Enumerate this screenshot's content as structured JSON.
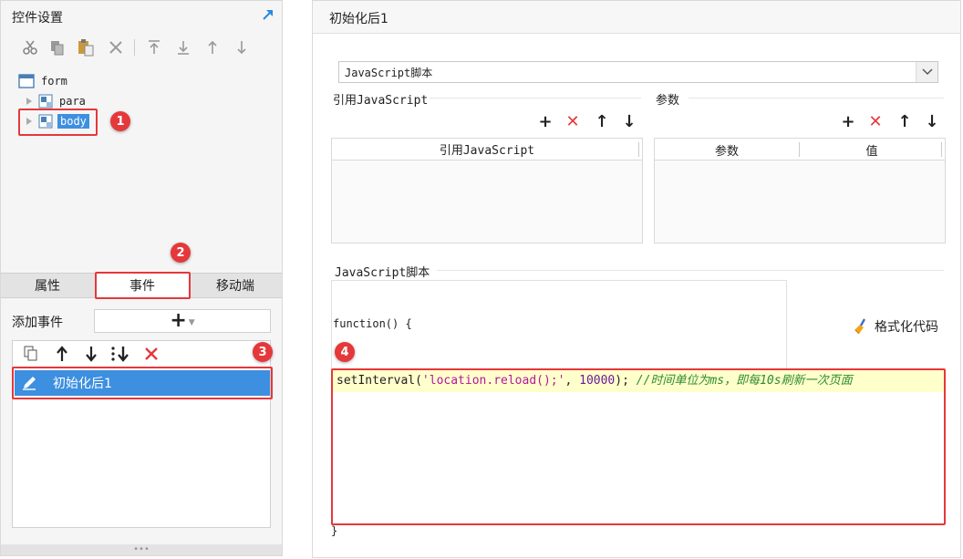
{
  "left_panel": {
    "title": "控件设置",
    "tree": {
      "root": "form",
      "children": [
        "para",
        "body"
      ]
    },
    "tabs": [
      "属性",
      "事件",
      "移动端"
    ],
    "add_event_label": "添加事件",
    "add_event_button": "+",
    "events": [
      "初始化后1"
    ]
  },
  "right_panel": {
    "title": "初始化后1",
    "script_type": "JavaScript脚本",
    "ref_js_label": "引用JavaScript",
    "ref_js_column": "引用JavaScript",
    "params_label": "参数",
    "params_columns": [
      "参数",
      "值"
    ],
    "script_section_label": "JavaScript脚本",
    "function_open": "function() {",
    "code": {
      "fn": "setInterval(",
      "str": "'location.reload();'",
      "sep": ", ",
      "num": "10000",
      "close": "); ",
      "comment_a": "//时间单位为",
      "comment_ms": "ms",
      "comment_b": "，即每",
      "comment_10s": "10s",
      "comment_c": "刷新一次页面"
    },
    "function_close": "}",
    "format_code_label": "格式化代码"
  },
  "callouts": [
    "1",
    "2",
    "3",
    "4"
  ],
  "colors": {
    "accent_red": "#e5383b",
    "selected_blue": "#3d8fe0",
    "panel_bg": "#f5f5f5",
    "highlight_yellow": "#ffffcc"
  }
}
